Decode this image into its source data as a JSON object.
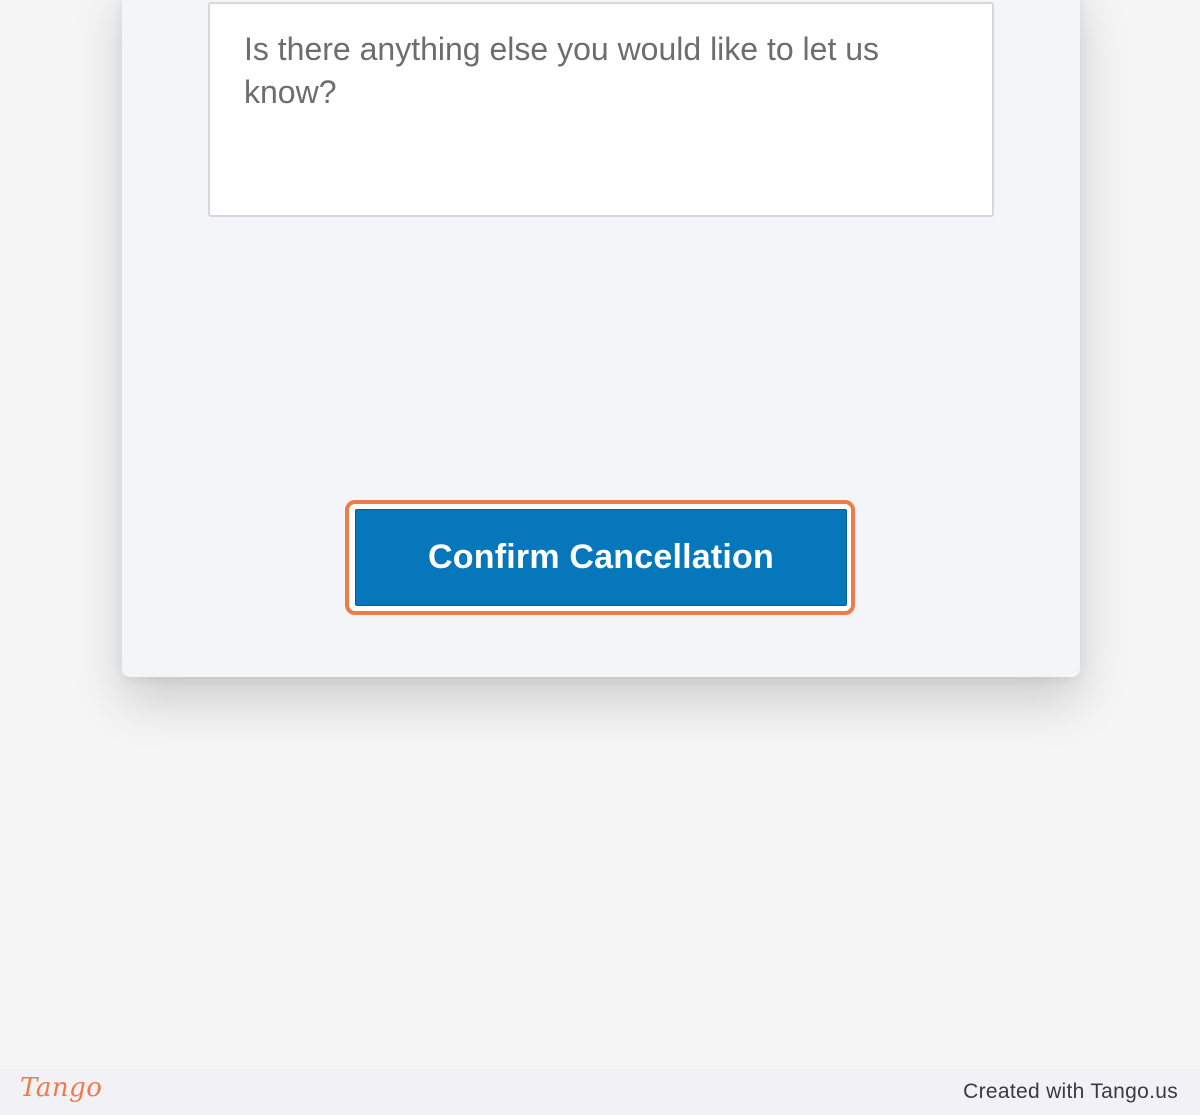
{
  "feedback": {
    "placeholder": "Is there anything else you would like to let us know?",
    "value": ""
  },
  "actions": {
    "confirm_label": "Confirm Cancellation"
  },
  "highlight": {
    "color": "#ef7a4a"
  },
  "theme": {
    "button_color": "#0677bb",
    "card_background": "#f4f5f9",
    "page_background": "#f5f5f6"
  },
  "footer": {
    "logo_text": "Tango",
    "created_with": "Created with Tango.us"
  }
}
